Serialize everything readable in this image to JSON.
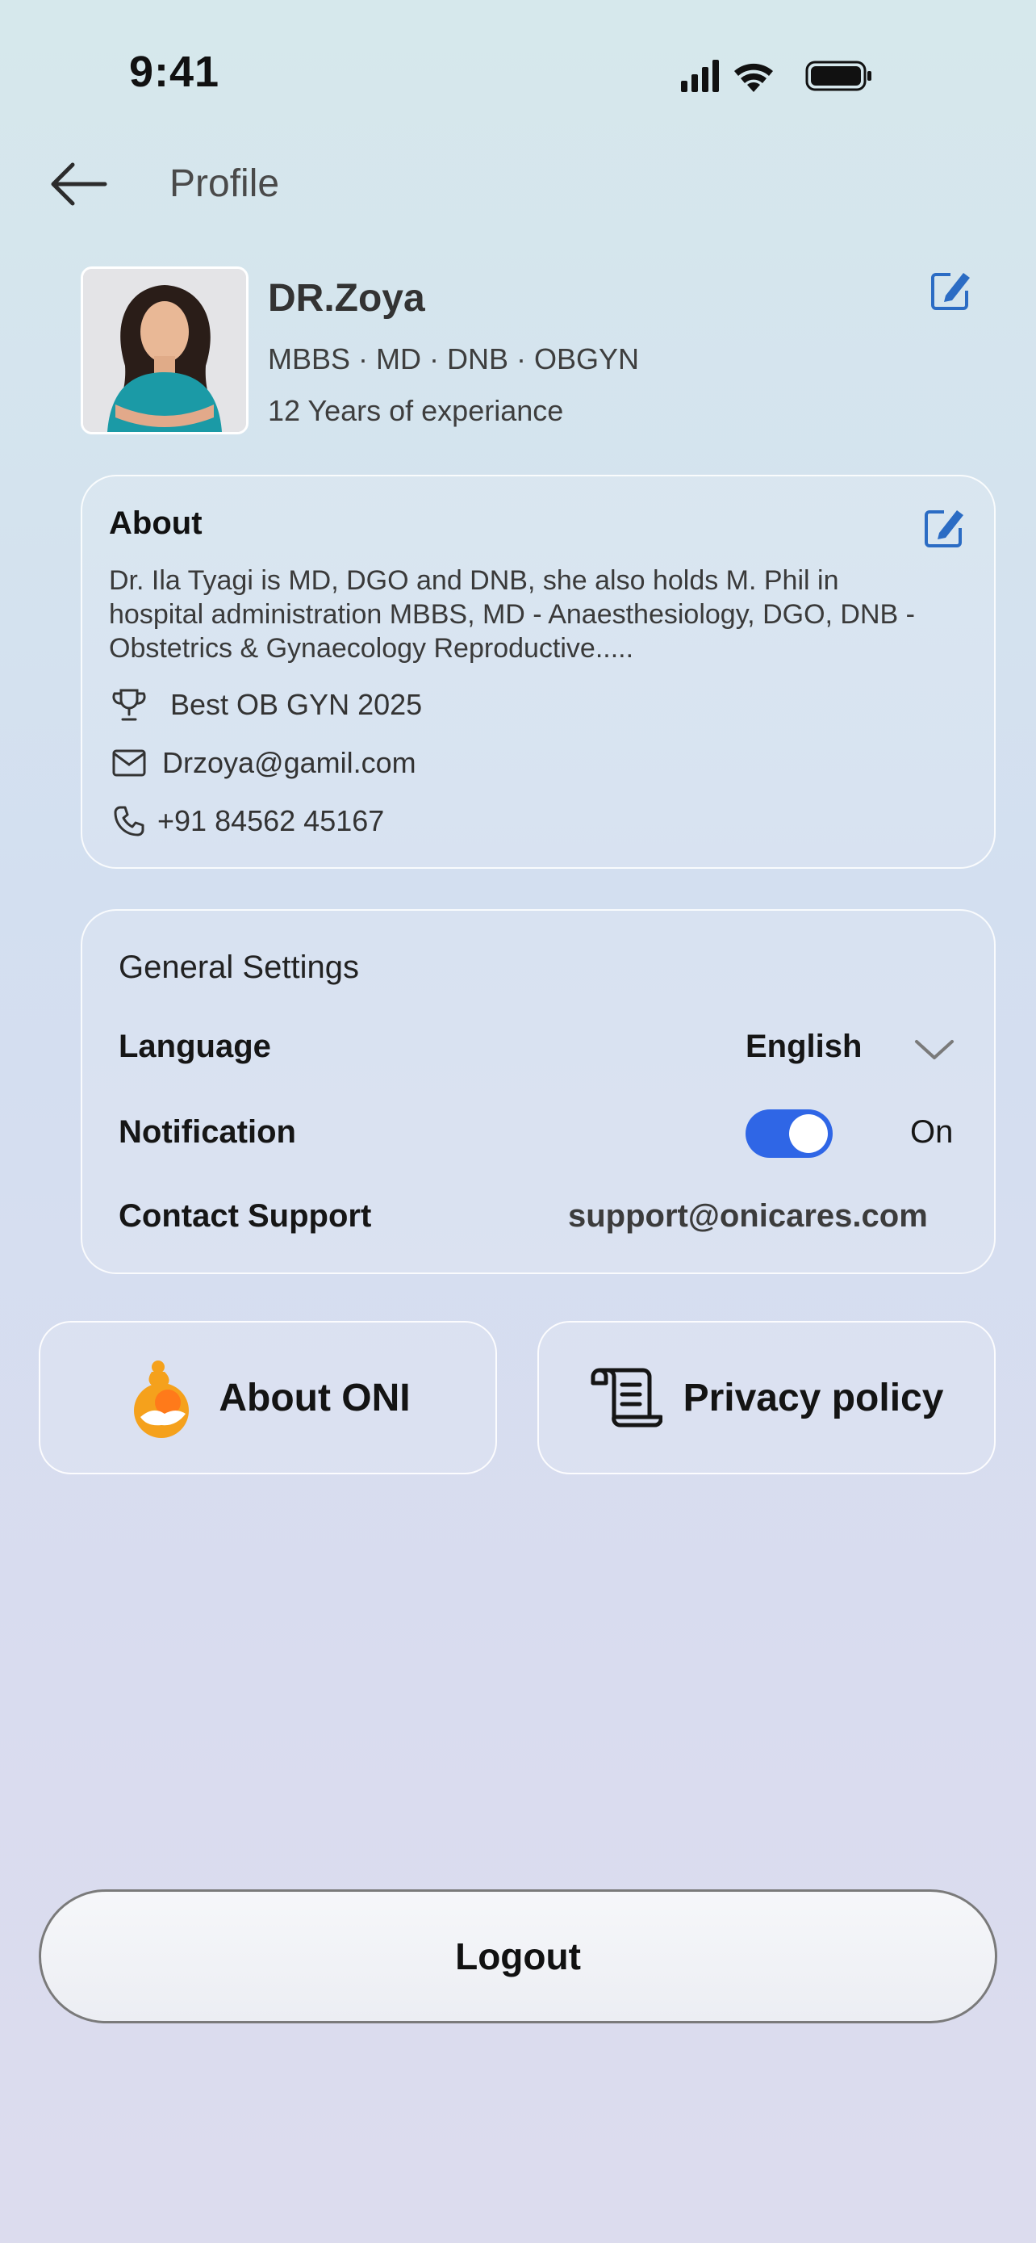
{
  "status_bar": {
    "time": "9:41"
  },
  "header": {
    "title": "Profile"
  },
  "profile": {
    "name": "DR.Zoya",
    "qualifications": "MBBS · MD · DNB  · OBGYN",
    "experience": "12 Years of experiance"
  },
  "about": {
    "title": "About",
    "text": "Dr. Ila Tyagi is MD, DGO and DNB, she also holds M. Phil in hospital administration MBBS, MD - Anaesthesiology, DGO, DNB - Obstetrics & Gynaecology Reproductive.....",
    "award": "Best OB GYN 2025",
    "email": "Drzoya@gamil.com",
    "phone": "+91 84562 45167"
  },
  "settings": {
    "title": "General Settings",
    "language_label": "Language",
    "language_value": "English",
    "notification_label": "Notification",
    "notification_state": "On",
    "notification_on": true,
    "support_label": "Contact Support",
    "support_value": "support@onicares.com"
  },
  "tiles": {
    "about_label": "About ONI",
    "privacy_label": "Privacy policy"
  },
  "logout_label": "Logout",
  "colors": {
    "accent": "#2f66e6",
    "edit_icon": "#2b6cc4",
    "oni_orange": "#f5a11c"
  },
  "icons": [
    "signal-icon",
    "wifi-icon",
    "battery-icon",
    "back-arrow-icon",
    "edit-icon",
    "trophy-icon",
    "mail-icon",
    "phone-icon",
    "chevron-down-icon",
    "oni-logo-icon",
    "scroll-document-icon"
  ]
}
